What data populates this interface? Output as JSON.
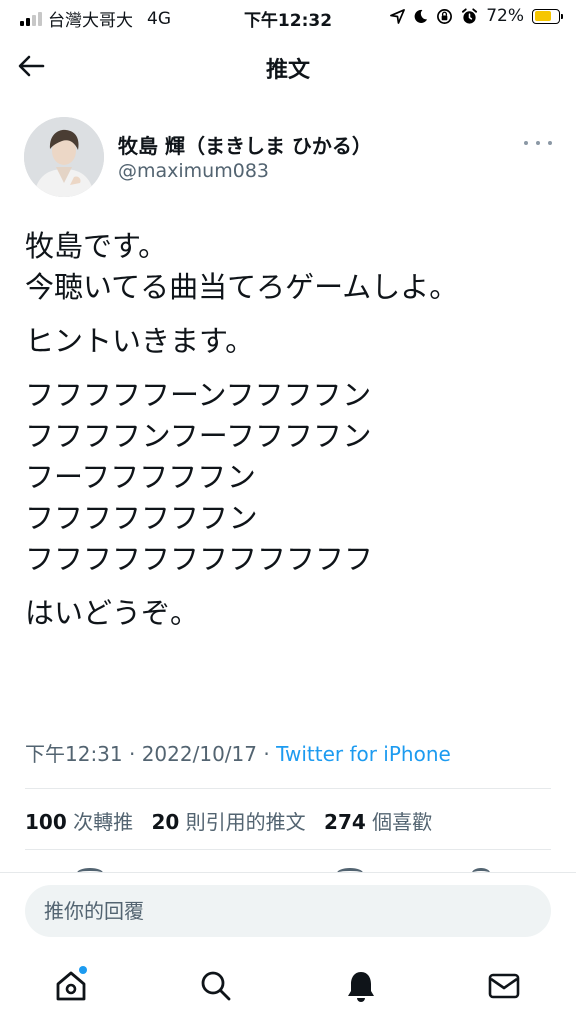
{
  "status_bar": {
    "carrier": "台灣大哥大",
    "network": "4G",
    "time": "下午12:32",
    "battery_percent": "72%",
    "battery_level": 0.72,
    "icons": [
      "location-arrow-icon",
      "moon-icon",
      "orientation-lock-icon",
      "alarm-icon"
    ]
  },
  "header": {
    "title": "推文",
    "back_icon": "back-arrow-icon"
  },
  "tweet": {
    "author_name": "牧島 輝（まきしま ひかる）",
    "author_handle": "@maximum083",
    "text_paragraphs": [
      [
        "牧島です。",
        "今聴いてる曲当てろゲームしよ。"
      ],
      [
        "ヒントいきます。"
      ],
      [
        "フフフフフーンフフフフン",
        "フフフフンフーフフフフン",
        "フーフフフフフン",
        "フフフフフフフン",
        "フフフフフフフフフフフフ"
      ],
      [
        "はいどうぞ。"
      ]
    ],
    "timestamp": "下午12:31 · 2022/10/17 · ",
    "source": "Twitter for iPhone"
  },
  "stats": {
    "retweets_count": "100",
    "retweets_label": "次轉推",
    "quotes_count": "20",
    "quotes_label": "則引用的推文",
    "likes_count": "274",
    "likes_label": "個喜歡"
  },
  "reply": {
    "placeholder": "推你的回覆"
  },
  "nav": {
    "items": [
      "home-icon",
      "search-icon",
      "notifications-bell-icon",
      "messages-envelope-icon"
    ],
    "home_has_unread_dot": true
  },
  "colors": {
    "accent": "#1d9bf0",
    "text": "#0f1419",
    "secondary_text": "#536471",
    "battery": "#f6c600"
  }
}
